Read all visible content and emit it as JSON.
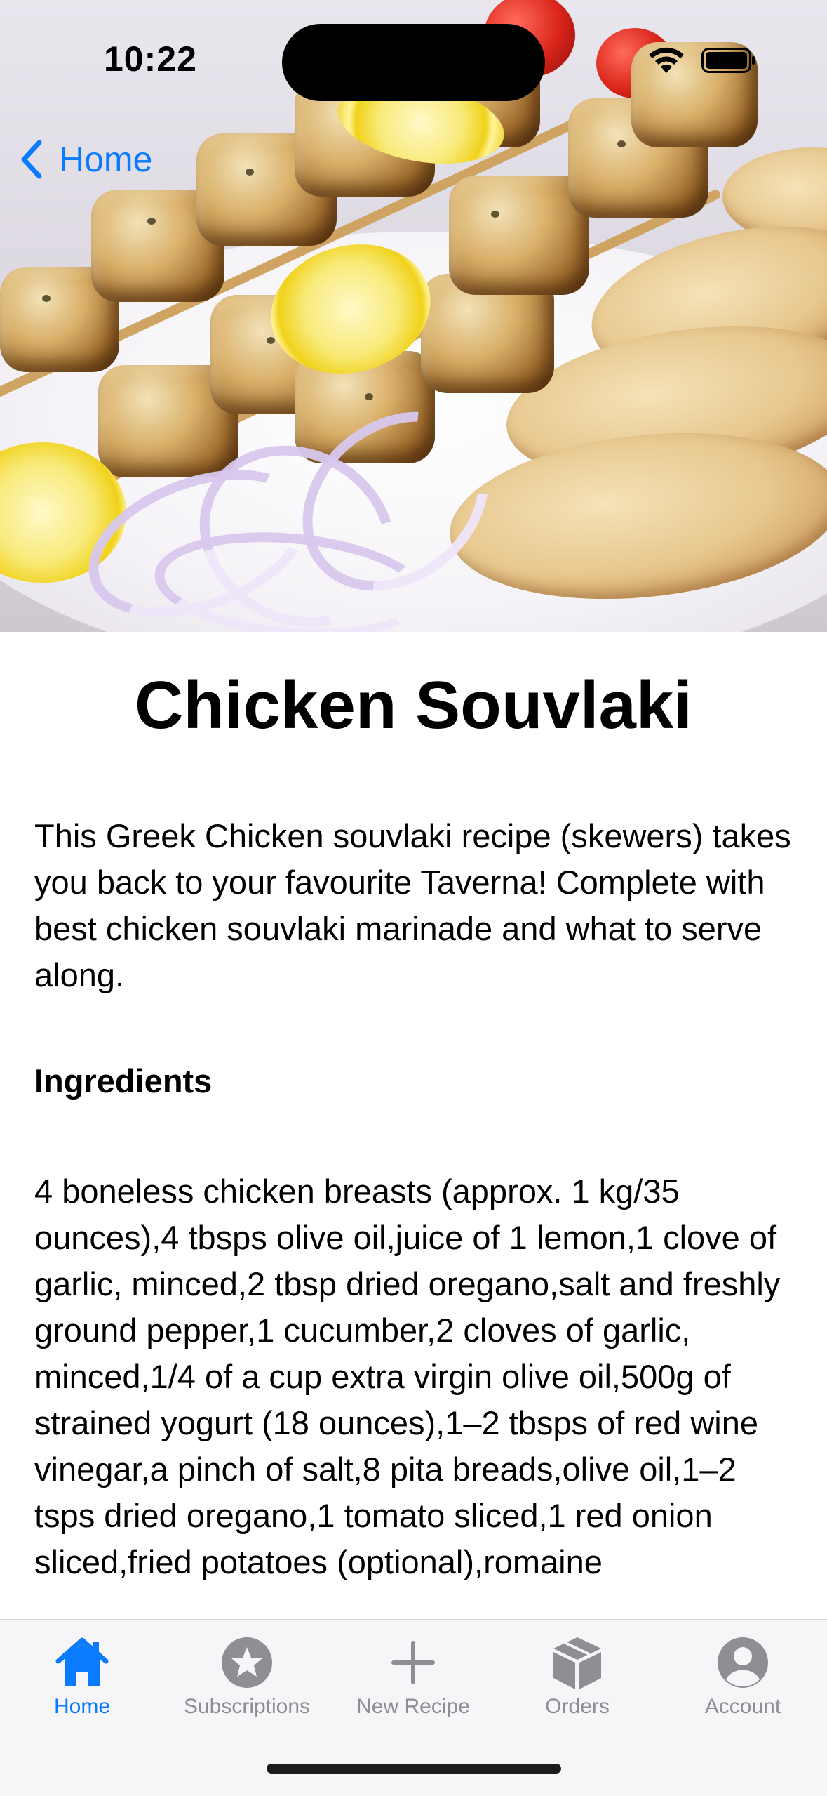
{
  "status_bar": {
    "time": "10:22"
  },
  "nav": {
    "back_label": "Home"
  },
  "recipe": {
    "title": "Chicken Souvlaki",
    "description": "This Greek Chicken souvlaki recipe (skewers) takes you back to your favourite Taverna! Complete with best chicken souvlaki marinade and what to serve along.",
    "ingredients_heading": "Ingredients",
    "ingredients_text": "4 boneless chicken breasts (approx. 1 kg/35 ounces),4 tbsps olive oil,juice of 1 lemon,1 clove of garlic, minced,2 tbsp dried oregano,salt and freshly ground pepper,1 cucumber,2 cloves of garlic, minced,1/4 of a cup extra virgin olive oil,500g of strained yogurt (18 ounces),1–2 tbsps of red wine vinegar,a pinch of salt,8 pita breads,olive oil,1–2 tsps dried oregano,1 tomato sliced,1 red onion sliced,fried potatoes (optional),romaine"
  },
  "tabbar": {
    "tabs": [
      {
        "label": "Home",
        "icon": "house-icon",
        "active": true
      },
      {
        "label": "Subscriptions",
        "icon": "star-icon",
        "active": false
      },
      {
        "label": "New Recipe",
        "icon": "plus-icon",
        "active": false
      },
      {
        "label": "Orders",
        "icon": "box-icon",
        "active": false
      },
      {
        "label": "Account",
        "icon": "person-icon",
        "active": false
      }
    ]
  },
  "colors": {
    "accent": "#0a7aff",
    "inactive": "#8e8e93",
    "tabbar_bg": "#f6f6f8"
  }
}
